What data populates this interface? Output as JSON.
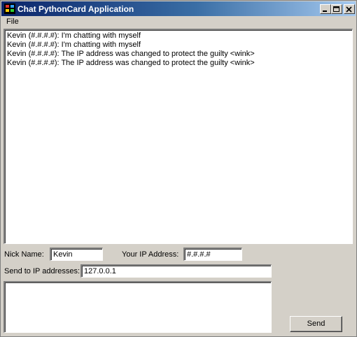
{
  "window": {
    "title": "Chat PythonCard Application"
  },
  "menu": {
    "file": "File"
  },
  "chat": {
    "lines": [
      "Kevin (#.#.#.#): I'm chatting with myself",
      "Kevin (#.#.#.#): I'm chatting with myself",
      "Kevin (#.#.#.#): The IP address was changed to protect the guilty <wink>",
      "Kevin (#.#.#.#): The IP address was changed to protect the guilty <wink>"
    ]
  },
  "form": {
    "nick_label": "Nick Name:",
    "nick_value": "Kevin",
    "ip_label": "Your IP Address:",
    "ip_value": "#.#.#.#",
    "send_to_label": "Send to IP addresses:",
    "send_to_value": "127.0.0.1",
    "message_value": ""
  },
  "buttons": {
    "send": "Send"
  }
}
